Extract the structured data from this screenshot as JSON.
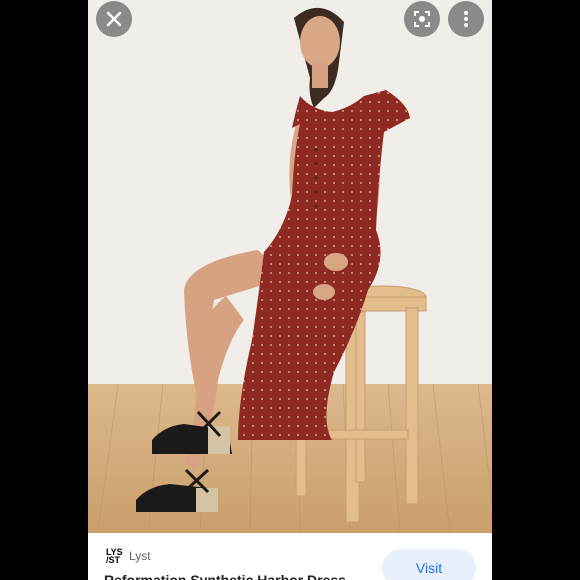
{
  "colors": {
    "frame": "#000000",
    "accent": "#1a73e8",
    "dress": "#8e2a22"
  },
  "viewer": {
    "toolbar": {
      "close_icon": "close-icon",
      "lens_icon": "lens-icon",
      "more_icon": "more-vert-icon"
    },
    "photo": {
      "subject": "woman-in-red-dress-on-stool"
    },
    "source": {
      "logo_line1": "LYS",
      "logo_line2": "/ST",
      "name": "Lyst"
    },
    "title": "Reformation Synthetic Harbor Dress",
    "visit_label": "Visit"
  }
}
